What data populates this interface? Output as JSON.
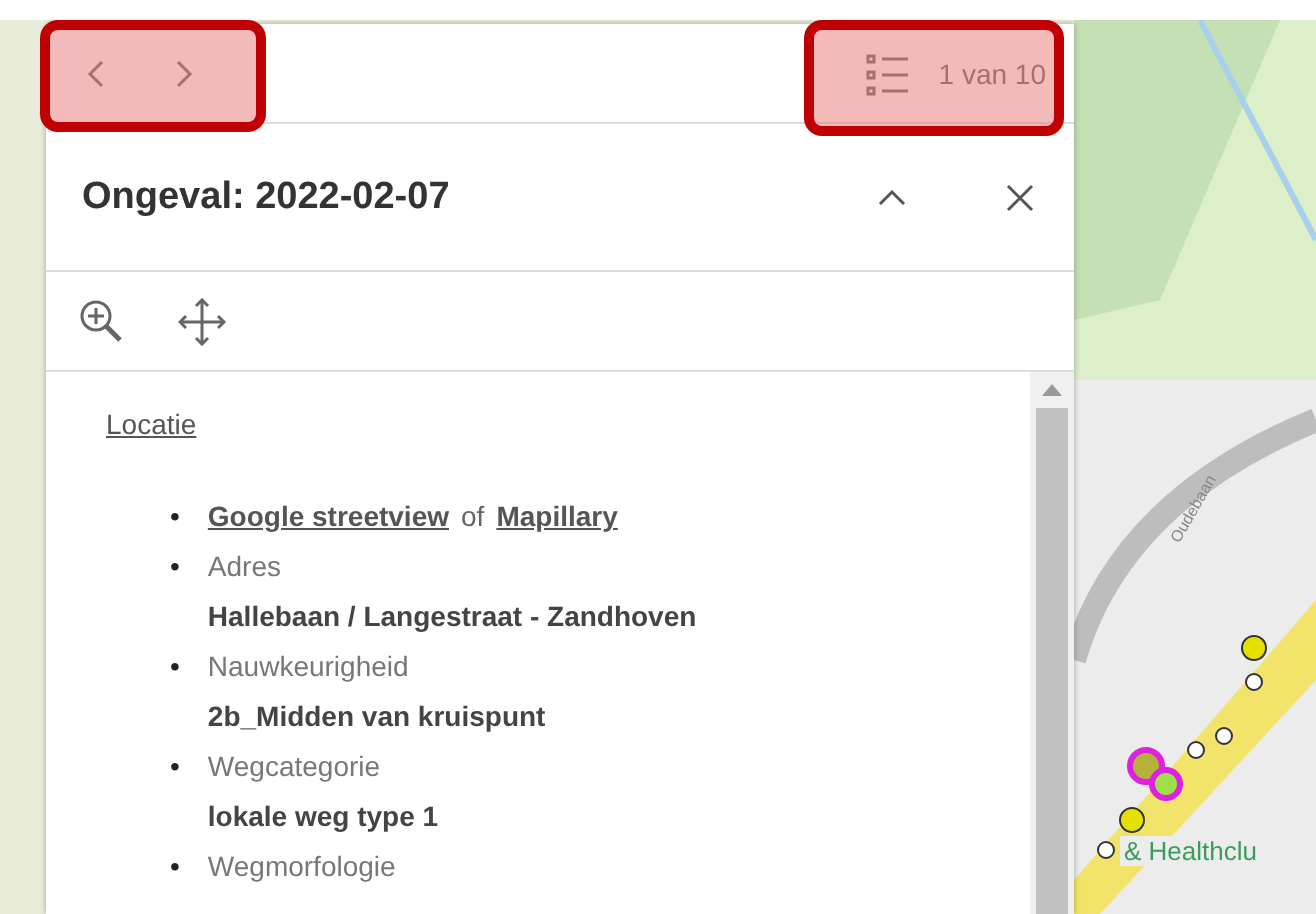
{
  "popup": {
    "counter": "1 van 10",
    "title": "Ongeval: 2022-02-07",
    "section_link": "Locatie",
    "bullet": "•",
    "items": [
      {
        "kind": "links",
        "first": "Google streetview",
        "connector": "of",
        "second": "Mapillary"
      },
      {
        "kind": "field",
        "label": "Adres",
        "value": "Hallebaan  / Langestraat - Zandhoven"
      },
      {
        "kind": "field",
        "label": "Nauwkeurigheid",
        "value": "2b_Midden van kruispunt"
      },
      {
        "kind": "field",
        "label": "Wegcategorie",
        "value": "lokale weg type 1"
      },
      {
        "kind": "field",
        "label": "Wegmorfologie"
      }
    ]
  },
  "map": {
    "street_label": "Oudebaan",
    "place_label": "& Healthclu"
  }
}
